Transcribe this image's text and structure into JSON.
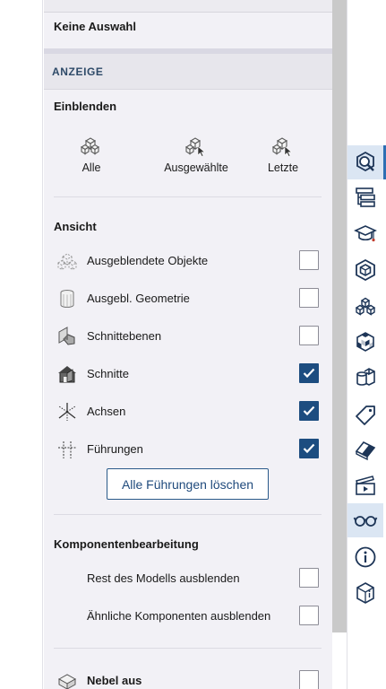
{
  "selection": {
    "title": "Keine Auswahl"
  },
  "section": {
    "title": "ANZEIGE"
  },
  "einblenden": {
    "title": "Einblenden",
    "buttons": [
      {
        "label": "Alle",
        "icon": "cubes-show-all-icon"
      },
      {
        "label": "Ausgewählte",
        "icon": "cubes-show-selected-icon"
      },
      {
        "label": "Letzte",
        "icon": "cubes-show-last-icon"
      }
    ]
  },
  "ansicht": {
    "title": "Ansicht",
    "rows": [
      {
        "label": "Ausgeblendete Objekte",
        "checked": false,
        "icon": "hidden-objects-icon"
      },
      {
        "label": "Ausgebl. Geometrie",
        "checked": false,
        "icon": "hidden-geometry-icon"
      },
      {
        "label": "Schnittebenen",
        "checked": false,
        "icon": "section-planes-icon"
      },
      {
        "label": "Schnitte",
        "checked": true,
        "icon": "section-cuts-icon"
      },
      {
        "label": "Achsen",
        "checked": true,
        "icon": "axes-icon"
      },
      {
        "label": "Führungen",
        "checked": true,
        "icon": "guides-icon"
      }
    ],
    "clear_guides_label": "Alle Führungen löschen"
  },
  "komponenten": {
    "title": "Komponentenbearbeitung",
    "rows": [
      {
        "label": "Rest des Modells ausblenden",
        "checked": false
      },
      {
        "label": "Ähnliche Komponenten ausblenden",
        "checked": false
      }
    ]
  },
  "fog": {
    "label": "Nebel aus",
    "checked": false,
    "icon": "fog-icon"
  },
  "toolbar": {
    "items": [
      {
        "icon": "entity-info-icon",
        "active": true
      },
      {
        "icon": "outliner-icon",
        "active": false
      },
      {
        "icon": "instructor-icon",
        "active": false
      },
      {
        "icon": "components-icon",
        "active": false
      },
      {
        "icon": "materials-icon",
        "active": false
      },
      {
        "icon": "styles-icon",
        "active": false
      },
      {
        "icon": "soften-edges-icon",
        "active": false
      },
      {
        "icon": "tags-icon",
        "active": false
      },
      {
        "icon": "eraser-icon",
        "active": false
      },
      {
        "icon": "scenes-icon",
        "active": false
      },
      {
        "icon": "display-glasses-icon",
        "active": true
      },
      {
        "icon": "info-icon",
        "active": false
      },
      {
        "icon": "model-info-icon",
        "active": false
      }
    ]
  },
  "colors": {
    "accent": "#1d4d80",
    "panel": "#f2f1f6",
    "header_text": "#2e4a68"
  }
}
